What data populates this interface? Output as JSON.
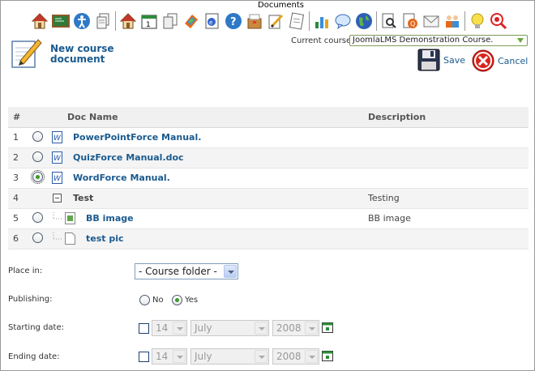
{
  "toolbar": {
    "active_label": "Documents",
    "icons": [
      "home-icon",
      "chalkboard-icon",
      "accessibility-icon",
      "documents-icon",
      "home-icon",
      "calendar-icon",
      "copy-icon",
      "links-icon",
      "web-icon",
      "help-icon",
      "dropbox-icon",
      "edit-icon",
      "notes-icon",
      "reports-icon",
      "chat-icon",
      "globe-icon",
      "search-icon",
      "quiz-icon",
      "mail-icon",
      "users-icon",
      "tips-icon",
      "search-zoom-icon"
    ]
  },
  "header": {
    "title": "New course document",
    "current_course_label": "Current course:",
    "current_course_value": "JoomlaLMS Demonstration Course.",
    "save_label": "Save",
    "cancel_label": "Cancel"
  },
  "table": {
    "columns": {
      "num": "#",
      "name": "Doc Name",
      "description": "Description"
    },
    "rows": [
      {
        "num": "1",
        "name": "PowerPointForce Manual.",
        "description": "",
        "type": "doc",
        "checked": false
      },
      {
        "num": "2",
        "name": "QuizForce Manual.doc",
        "description": "",
        "type": "doc",
        "checked": false
      },
      {
        "num": "3",
        "name": "WordForce Manual.",
        "description": "",
        "type": "doc",
        "checked": true
      },
      {
        "num": "4",
        "name": "Test",
        "description": "Testing",
        "type": "folder",
        "checked": false
      },
      {
        "num": "5",
        "name": "BB image",
        "description": "BB image",
        "type": "image",
        "checked": false
      },
      {
        "num": "6",
        "name": "test pic",
        "description": "",
        "type": "blank",
        "checked": false
      }
    ]
  },
  "form": {
    "place_in_label": "Place in:",
    "place_in_value": "- Course folder -",
    "publishing_label": "Publishing:",
    "publishing_no": "No",
    "publishing_yes": "Yes",
    "publishing_selected": "Yes",
    "starting_date_label": "Starting date:",
    "ending_date_label": "Ending date:",
    "start_day": "14",
    "start_month": "July",
    "start_year": "2008",
    "end_day": "14",
    "end_month": "July",
    "end_year": "2008"
  }
}
